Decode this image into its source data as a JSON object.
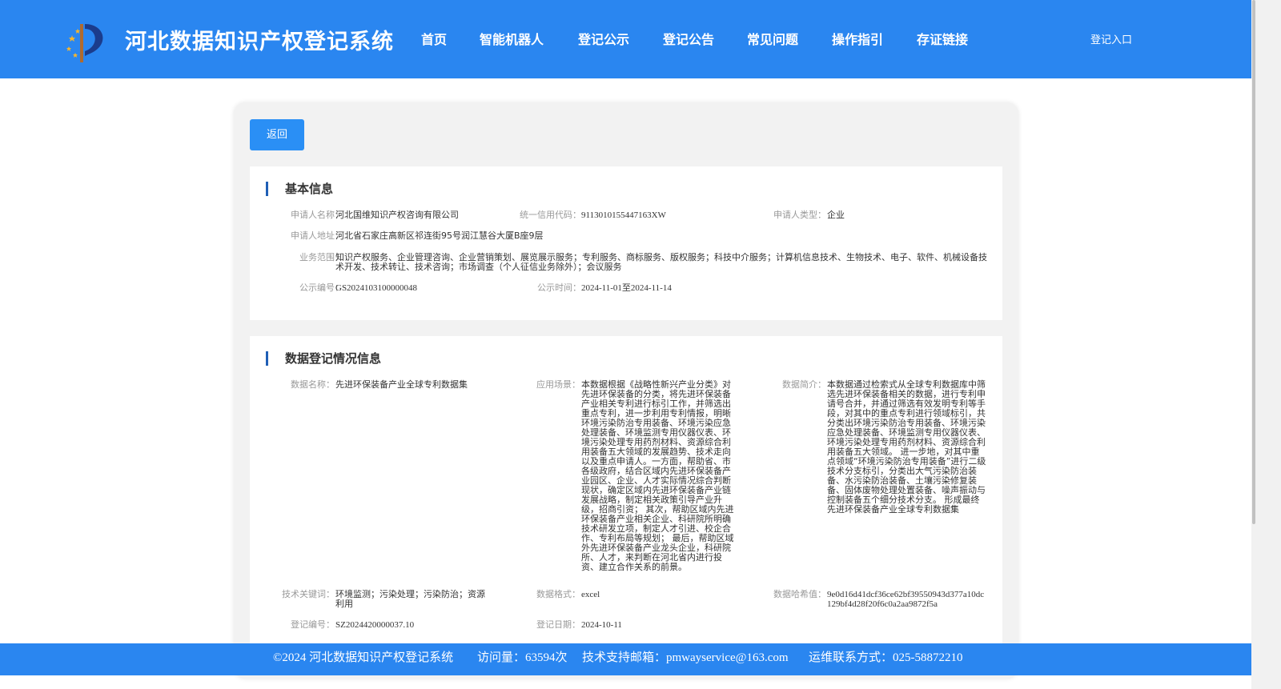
{
  "header": {
    "site_title": "河北数据知识产权登记系统",
    "nav": [
      {
        "label": "首页"
      },
      {
        "label": "智能机器人"
      },
      {
        "label": "登记公示"
      },
      {
        "label": "登记公告"
      },
      {
        "label": "常见问题"
      },
      {
        "label": "操作指引"
      },
      {
        "label": "存证链接"
      }
    ],
    "login_label": "登记入口",
    "logo_icon": "hebei-ip-logo-icon"
  },
  "actions": {
    "back_label": "返回"
  },
  "basic_info": {
    "title": "基本信息",
    "applicant_name_label": "申请人名称：",
    "applicant_name": "河北国维知识产权咨询有限公司",
    "credit_code_label": "统一信用代码：",
    "credit_code": "911301015544 7163XW",
    "applicant_type_label": "申请人类型：",
    "applicant_type": "企业",
    "address_label": "申请人地址：",
    "address": "河北省石家庄高新区祁连街95号润江慧谷大厦B座9层",
    "scope_label": "业务范围：",
    "scope": "知识产权服务、企业管理咨询、企业营销策划、展览展示服务；专利服务、商标服务、版权服务；科技中介服务；计算机信息技术、生物技术、电子、软件、机械设备技术开发、技术转让、技术咨询；市场调查（个人征信业务除外）；会议服务",
    "notice_no_label": "公示编号：",
    "notice_no": "GS2024103100000048",
    "notice_time_label": "公示时间：",
    "notice_time": "2024-11-01至2024-11-14"
  },
  "data_info": {
    "title": "数据登记情况信息",
    "data_name_label": "数据名称：",
    "data_name": "先进环保装备产业全球专利数据集",
    "scenario_label": "应用场景：",
    "scenario": "本数据根据《战略性新兴产业分类》对先进环保装备的分类，将先进环保装备产业相关专利进行标引工作，并筛选出重点专利，进一步利用专利情报，明晰环境污染防治专用装备、环境污染应急处理装备、环境监测专用仪器仪表、环境污染处理专用药剂材料、资源综合利用装备五大领域的发展趋势、技术走向以及重点申请人。一方面，帮助省、市各级政府，结合区域内先进环保装备产业园区、企业、人才实际情况综合判断现状，确定区域内先进环保装备产业链发展战略，制定相关政策引导产业升级，招商引资； 其次，帮助区域内先进环保装备产业相关企业、科研院所明确技术研发立项，制定人才引进、校企合作、专利布局等规划； 最后，帮助区域外先进环保装备产业龙头企业，科研院所、人才，来判断在河北省内进行投资、建立合作关系的前景。",
    "summary_label": "数据简介：",
    "summary": "本数据通过检索式从全球专利数据库中筛选先进环保装备相关的数据，进行专利申请号合并，并通过筛选有效发明专利等手段，对其中的重点专利进行领域标引，共分类出环境污染防治专用装备、环境污染应急处理装备、环境监测专用仪器仪表、环境污染处理专用药剂材料、资源综合利用装备五大领域。 进一步地，对其中重点领域“环境污染防治专用装备”进行二级技术分支标引，分类出大气污染防治装备、水污染防治装备、土壤污染修复装备、固体废物处理处置装备、噪声振动与控制装备五个细分技术分支。 形成最终先进环保装备产业全球专利数据集",
    "keywords_label": "技术关键词：",
    "keywords": "环境监测；污染处理；污染防治；资源利用",
    "format_label": "数据格式：",
    "format": "excel",
    "hash_label": "数据哈希值：",
    "hash": "9e0d16d41dcf36ce62bf39550943d377a10dc129bf4d28f20f6c0a2aa9872f5a",
    "reg_no_label": "登记编号：",
    "reg_no": "SZ2024420000037.10",
    "reg_date_label": "登记日期：",
    "reg_date": "2024-10-11"
  },
  "footer": {
    "copyright": "©2024 河北数据知识产权登记系统",
    "visits": "访问量：63594次",
    "support_email": "技术支持邮箱：pmwayservice@163.com",
    "ops_contact": "运维联系方式：025-58872210"
  },
  "colors": {
    "header_bg": "#2a86f0",
    "button_bg": "#2a8ff5",
    "title_accent": "#1f5fb6"
  }
}
